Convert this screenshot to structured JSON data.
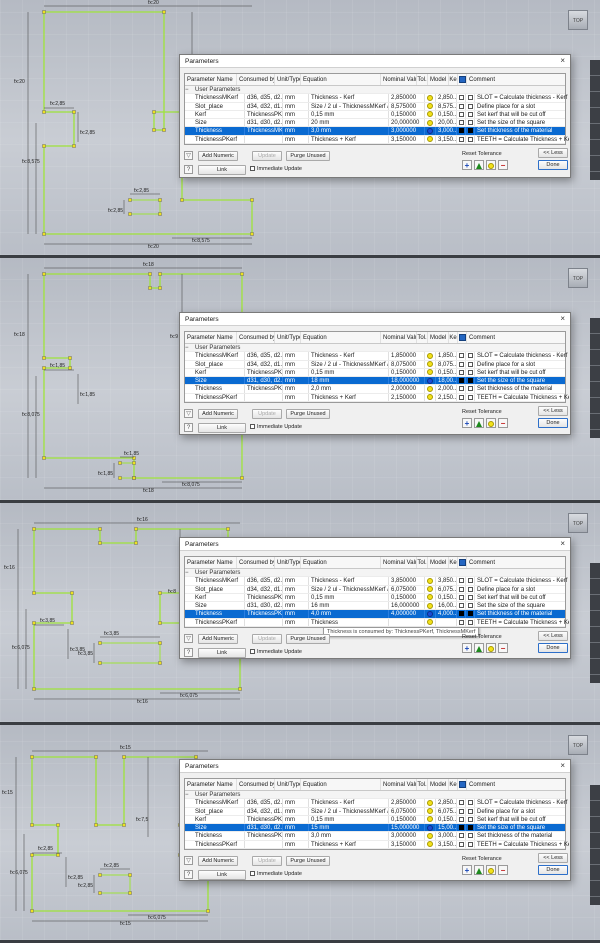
{
  "panels": [
    {
      "dialog_title": "Parameters",
      "dims": {
        "top": "fx:20",
        "right": "fx:10",
        "left": "fx:20",
        "l1": "fx:2,85",
        "l2": "fx:2,85",
        "l3": "fx:2,85",
        "l4": "fx:8,575",
        "mid": "fx:2,85",
        "b1": "fx:2,85",
        "b2": "fx:2,85",
        "bottom": "fx:20",
        "bottom2": "fx:8,575"
      },
      "rows": [
        {
          "name": "ThicknessMKerf",
          "consumed": "d36, d35, d2...",
          "unit": "mm",
          "eq": "Thickness - Kerf",
          "nominal": "2,850000",
          "tol": "yellow",
          "model": "2,850...",
          "key": false,
          "export": false,
          "comment": "SLOT = Calculate thickness - Kerf",
          "selected": false
        },
        {
          "name": "Slot_place",
          "consumed": "d34, d32, d1...",
          "unit": "mm",
          "eq": "Size / 2 ul - ThicknessMKerf / 2 ul",
          "nominal": "8,575000",
          "tol": "yellow",
          "model": "8,575...",
          "key": false,
          "export": false,
          "comment": "Define place for a slot",
          "selected": false
        },
        {
          "name": "Kerf",
          "consumed": "ThicknessPKe...",
          "unit": "mm",
          "eq": "0,15 mm",
          "nominal": "0,150000",
          "tol": "yellow",
          "model": "0,150...",
          "key": false,
          "export": false,
          "comment": "Set kerf that will be cut off",
          "selected": false
        },
        {
          "name": "Size",
          "consumed": "d31, d30, d2...",
          "unit": "mm",
          "eq": "20 mm",
          "nominal": "20,000000",
          "tol": "yellow",
          "model": "20,00...",
          "key": false,
          "export": false,
          "comment": "Set the size of the square",
          "selected": false
        },
        {
          "name": "Thickness",
          "consumed": "ThicknessMK...",
          "unit": "mm",
          "eq": "3,0 mm",
          "nominal": "3,000000",
          "tol": "blue",
          "model": "3,000...",
          "key": true,
          "export": true,
          "comment": "Set thickness of the material",
          "selected": true
        },
        {
          "name": "ThicknessPKerf",
          "consumed": "",
          "unit": "mm",
          "eq": "Thickness + Kerf",
          "nominal": "3,150000",
          "tol": "yellow",
          "model": "3,150...",
          "key": false,
          "export": false,
          "comment": "TEETH = Calculate Thickness + Kerf",
          "selected": false
        }
      ]
    },
    {
      "dialog_title": "Parameters",
      "dims": {
        "top": "fx:18",
        "right": "fx:9",
        "left": "fx:18",
        "l1": "fx:1,85",
        "l2": "fx:1,85",
        "l3": "fx:1,85",
        "l4": "fx:8,075",
        "mid": "fx:1,85",
        "b1": "fx:1,85",
        "b2": "fx:1,85",
        "bottom": "fx:18",
        "bottom2": "fx:8,075"
      },
      "rows": [
        {
          "name": "ThicknessMKerf",
          "consumed": "d36, d35, d2...",
          "unit": "mm",
          "eq": "Thickness - Kerf",
          "nominal": "1,850000",
          "tol": "yellow",
          "model": "1,850...",
          "key": false,
          "export": false,
          "comment": "SLOT = Calculate thickness - Kerf",
          "selected": false
        },
        {
          "name": "Slot_place",
          "consumed": "d34, d32, d1...",
          "unit": "mm",
          "eq": "Size / 2 ul - ThicknessMKerf / 2 ul",
          "nominal": "8,075000",
          "tol": "yellow",
          "model": "8,075...",
          "key": false,
          "export": false,
          "comment": "Define place for a slot",
          "selected": false
        },
        {
          "name": "Kerf",
          "consumed": "ThicknessPKe...",
          "unit": "mm",
          "eq": "0,15 mm",
          "nominal": "0,150000",
          "tol": "yellow",
          "model": "0,150...",
          "key": false,
          "export": false,
          "comment": "Set kerf that will be cut off",
          "selected": false
        },
        {
          "name": "Size",
          "consumed": "d31, d30, d2...",
          "unit": "mm",
          "eq": "18 mm",
          "nominal": "18,000000",
          "tol": "blue",
          "model": "18,00...",
          "key": true,
          "export": true,
          "comment": "Set the size of the square",
          "selected": true
        },
        {
          "name": "Thickness",
          "consumed": "ThicknessPKe...",
          "unit": "mm",
          "eq": "2,0 mm",
          "nominal": "2,000000",
          "tol": "yellow",
          "model": "2,000...",
          "key": false,
          "export": false,
          "comment": "Set thickness of the material",
          "selected": false
        },
        {
          "name": "ThicknessPKerf",
          "consumed": "",
          "unit": "mm",
          "eq": "Thickness + Kerf",
          "nominal": "2,150000",
          "tol": "yellow",
          "model": "2,150...",
          "key": false,
          "export": false,
          "comment": "TEETH = Calculate Thickness + Kerf",
          "selected": false
        }
      ]
    },
    {
      "dialog_title": "Parameters",
      "tooltip": "Thickness is consumed by: ThicknessPKerf, ThicknessMKerf",
      "dims": {
        "top": "fx:16",
        "right": "fx:8",
        "left": "fx:16",
        "l1": "fx:3,85",
        "l2": "fx:3,85",
        "l3": "fx:3,85",
        "l4": "fx:6,075",
        "mid": "fx:3,85",
        "b1": "fx:3,85",
        "b2": "fx:3,85",
        "bottom": "fx:16",
        "bottom2": "fx:6,075"
      },
      "rows": [
        {
          "name": "ThicknessMKerf",
          "consumed": "d36, d35, d2...",
          "unit": "mm",
          "eq": "Thickness - Kerf",
          "nominal": "3,850000",
          "tol": "yellow",
          "model": "3,850...",
          "key": false,
          "export": false,
          "comment": "SLOT = Calculate thickness - Kerf",
          "selected": false
        },
        {
          "name": "Slot_place",
          "consumed": "d34, d32, d1...",
          "unit": "mm",
          "eq": "Size / 2 ul - ThicknessMKerf / 2 ul",
          "nominal": "6,075000",
          "tol": "yellow",
          "model": "6,075...",
          "key": false,
          "export": false,
          "comment": "Define place for a slot",
          "selected": false
        },
        {
          "name": "Kerf",
          "consumed": "ThicknessPKe...",
          "unit": "mm",
          "eq": "0,15 mm",
          "nominal": "0,150000",
          "tol": "yellow",
          "model": "0,150...",
          "key": false,
          "export": false,
          "comment": "Set kerf that will be cut off",
          "selected": false
        },
        {
          "name": "Size",
          "consumed": "d31, d30, d2...",
          "unit": "mm",
          "eq": "16 mm",
          "nominal": "16,000000",
          "tol": "yellow",
          "model": "16,00...",
          "key": false,
          "export": false,
          "comment": "Set the size of the square",
          "selected": false
        },
        {
          "name": "Thickness",
          "consumed": "ThicknessPKe...",
          "unit": "mm",
          "eq": "4,0 mm",
          "nominal": "4,000000",
          "tol": "blue",
          "model": "4,000...",
          "key": true,
          "export": true,
          "comment": "Set thickness of the material",
          "selected": true
        },
        {
          "name": "ThicknessPKerf",
          "consumed": "",
          "unit": "mm",
          "eq": "Thickness",
          "nominal": "",
          "tol": "yellow",
          "model": "",
          "key": false,
          "export": false,
          "comment": "TEETH = Calculate Thickness + Kerf",
          "selected": false
        }
      ]
    },
    {
      "dialog_title": "Parameters",
      "dims": {
        "top": "fx:15",
        "right": "fx:7,5",
        "left": "fx:15",
        "l1": "fx:2,85",
        "l2": "fx:2,85",
        "l3": "fx:2,85",
        "l4": "fx:6,075",
        "mid": "fx:2,85",
        "b1": "fx:2,85",
        "b2": "fx:2,85",
        "bottom": "fx:15",
        "bottom2": "fx:6,075"
      },
      "rows": [
        {
          "name": "ThicknessMKerf",
          "consumed": "d36, d35, d2...",
          "unit": "mm",
          "eq": "Thickness - Kerf",
          "nominal": "2,850000",
          "tol": "yellow",
          "model": "2,850...",
          "key": false,
          "export": false,
          "comment": "SLOT = Calculate thickness - Kerf",
          "selected": false
        },
        {
          "name": "Slot_place",
          "consumed": "d34, d32, d1...",
          "unit": "mm",
          "eq": "Size / 2 ul - ThicknessMKerf / 2 ul",
          "nominal": "6,075000",
          "tol": "yellow",
          "model": "6,075...",
          "key": false,
          "export": false,
          "comment": "Define place for a slot",
          "selected": false
        },
        {
          "name": "Kerf",
          "consumed": "ThicknessPKe...",
          "unit": "mm",
          "eq": "0,15 mm",
          "nominal": "0,150000",
          "tol": "yellow",
          "model": "0,150...",
          "key": false,
          "export": false,
          "comment": "Set kerf that will be cut off",
          "selected": false
        },
        {
          "name": "Size",
          "consumed": "d31, d30, d2...",
          "unit": "mm",
          "eq": "15 mm",
          "nominal": "15,000000",
          "tol": "blue",
          "model": "15,00...",
          "key": true,
          "export": true,
          "comment": "Set the size of the square",
          "selected": true
        },
        {
          "name": "Thickness",
          "consumed": "ThicknessPKe...",
          "unit": "mm",
          "eq": "3,0 mm",
          "nominal": "3,000000",
          "tol": "yellow",
          "model": "3,000...",
          "key": false,
          "export": false,
          "comment": "Set thickness of the material",
          "selected": false
        },
        {
          "name": "ThicknessPKerf",
          "consumed": "",
          "unit": "mm",
          "eq": "Thickness + Kerf",
          "nominal": "3,150000",
          "tol": "yellow",
          "model": "3,150...",
          "key": false,
          "export": false,
          "comment": "TEETH = Calculate Thickness + Kerf",
          "selected": false
        }
      ]
    }
  ],
  "columns": [
    "Parameter Name",
    "Consumed by",
    "Unit/Type",
    "Equation",
    "Nominal Value",
    "Tol.",
    "Model Va",
    "Ke",
    "",
    "Comment"
  ],
  "group_label": "User Parameters",
  "buttons": {
    "add_numeric": "Add Numeric",
    "update": "Update",
    "purge": "Purge Unused",
    "link": "Link",
    "immediate": "Immediate Update",
    "reset_tolerance": "Reset Tolerance",
    "less": "<< Less",
    "done": "Done"
  },
  "viewcube_label": "TOP",
  "colors": {
    "selection": "#0a6ad1",
    "sketch_line": "#9ee33a",
    "constraint_point": "#f0e020"
  }
}
